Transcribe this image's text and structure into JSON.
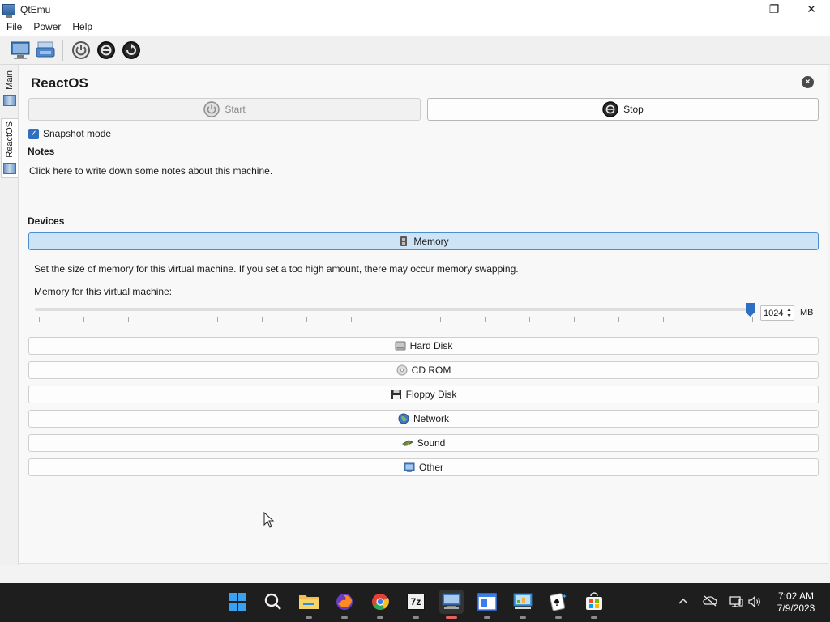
{
  "window": {
    "title": "QtEmu",
    "minimize": "—",
    "maximize": "❐",
    "close": "✕"
  },
  "menu": {
    "items": [
      "File",
      "Power",
      "Help"
    ]
  },
  "sidebar": {
    "tabs": [
      "Main",
      "ReactOS"
    ]
  },
  "vm": {
    "name": "ReactOS",
    "close_icon": "×",
    "start_label": "Start",
    "stop_label": "Stop",
    "snapshot_label": "Snapshot mode",
    "snapshot_checked": true
  },
  "notes": {
    "heading": "Notes",
    "placeholder": "Click here to write down some notes about this machine."
  },
  "devices": {
    "heading": "Devices",
    "items": [
      "Memory",
      "Hard Disk",
      "CD ROM",
      "Floppy Disk",
      "Network",
      "Sound",
      "Other"
    ],
    "active": "Memory"
  },
  "memory": {
    "description": "Set the size of memory for this virtual machine. If you set a too high amount, there may occur memory swapping.",
    "label": "Memory for this virtual machine:",
    "value": "1024",
    "unit": "MB",
    "slider_fraction": 0.99
  },
  "taskbar": {
    "clock_time": "7:02 AM",
    "clock_date": "7/9/2023",
    "apps": [
      "start-icon",
      "search-icon",
      "file-explorer-icon",
      "firefox-icon",
      "chrome-icon",
      "7zip-icon",
      "qtemu-icon",
      "notepad-icon",
      "control-panel-icon",
      "solitaire-icon",
      "store-icon"
    ],
    "sevenzip_label": "7z"
  },
  "colors": {
    "accent": "#2f6fc1",
    "active_device_bg": "#cde4f7",
    "taskbar_bg": "#1e1e1e"
  }
}
